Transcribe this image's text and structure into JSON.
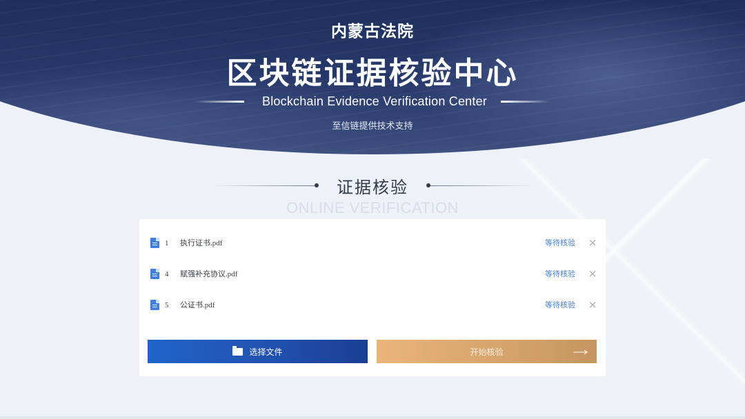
{
  "header": {
    "court_name": "内蒙古法院",
    "title": "区块链证据核验中心",
    "title_en": "Blockchain Evidence Verification Center",
    "support_text": "至信链提供技术支持"
  },
  "section": {
    "title": "证据核验",
    "title_en": "ONLINE VERIFICATION"
  },
  "files": [
    {
      "name": "1      执行证书.pdf",
      "status": "等待核验",
      "remove_icon": "×"
    },
    {
      "name": "4      赋强补充协议.pdf",
      "status": "等待核验",
      "remove_icon": "×"
    },
    {
      "name": "5      公证书.pdf",
      "status": "等待核验",
      "remove_icon": "×"
    }
  ],
  "buttons": {
    "select_label": "选择文件",
    "start_label": "开始核验"
  },
  "icons": {
    "file": "file-icon",
    "folder": "folder-icon",
    "arrow": "arrow-right-icon",
    "close": "close-icon"
  },
  "colors": {
    "header_bg": "#1d2f5c",
    "select_button": "#2253b3",
    "start_button": "#d7a46d",
    "status_text": "#4a84d4"
  }
}
